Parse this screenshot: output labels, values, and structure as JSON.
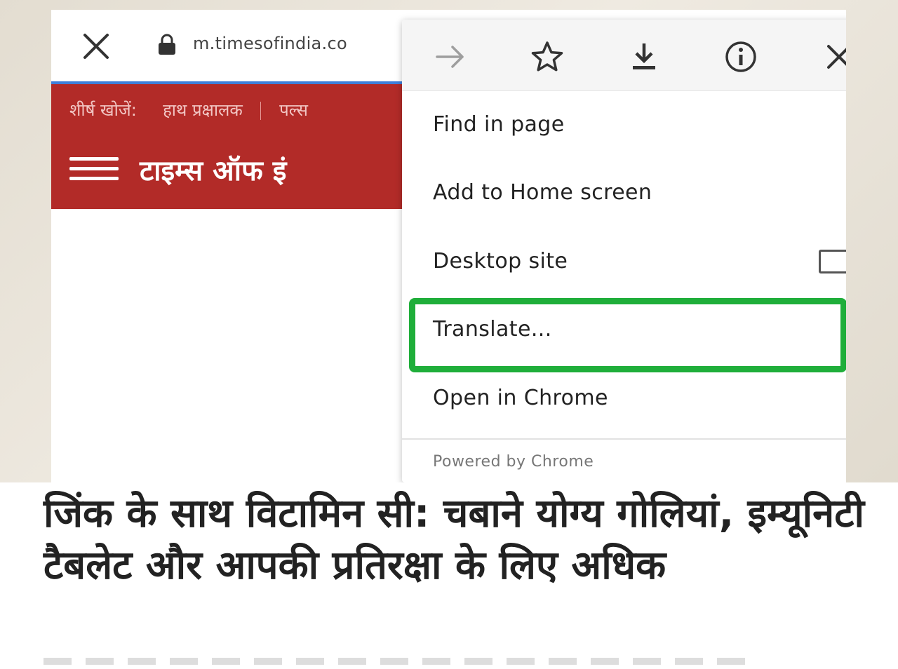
{
  "browser": {
    "url": "m.timesofindia.co",
    "close_icon": "close-icon",
    "lock_icon": "lock-icon"
  },
  "site": {
    "top_searches_label": "शीर्ष खोजें:",
    "search_term_1": "हाथ प्रक्षालक",
    "search_term_2": "पल्स",
    "title": "टाइम्स ऑफ इं",
    "bar_color": "#b22b28"
  },
  "menu": {
    "icons": [
      "forward-arrow-icon",
      "star-icon",
      "download-icon",
      "info-icon",
      "close-icon"
    ],
    "items": [
      {
        "label": "Find in page"
      },
      {
        "label": "Add to Home screen"
      },
      {
        "label": "Desktop site",
        "checked": false
      },
      {
        "label": "Translate..."
      },
      {
        "label": "Open in Chrome"
      }
    ],
    "footer": "Powered by Chrome",
    "highlight_color": "#1fae3a"
  },
  "headline": {
    "text": "जिंक के साथ विटामिन सी: चबाने योग्य गोलियां, इम्यूनिटी टैबलेट और आपकी प्रतिरक्षा के लिए अधिक"
  }
}
